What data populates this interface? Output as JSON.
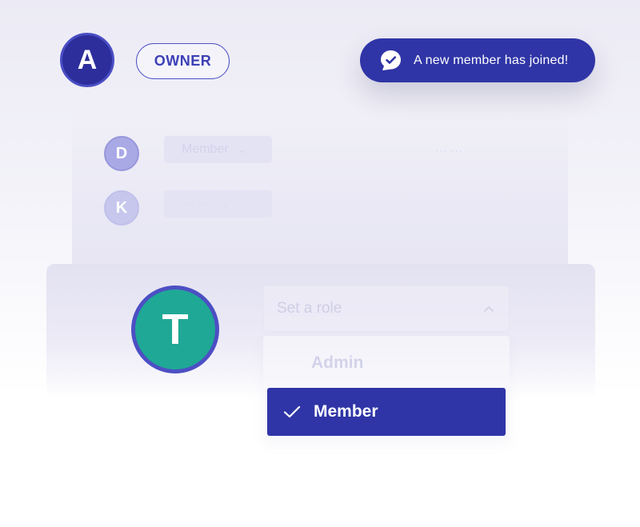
{
  "owner": {
    "avatar_initial": "A",
    "badge_label": "OWNER"
  },
  "toast": {
    "icon": "chat-check-icon",
    "message": "A new member has joined!"
  },
  "members": [
    {
      "initial": "D",
      "role": "Member",
      "extra": "··· ···"
    },
    {
      "initial": "K",
      "role": "··· ···"
    }
  ],
  "new_member": {
    "initial": "T",
    "select_placeholder": "Set a role",
    "options": [
      {
        "label": "Admin",
        "selected": false
      },
      {
        "label": "Member",
        "selected": true
      }
    ]
  },
  "colors": {
    "primary": "#2f35a6",
    "owner_avatar": "#2d2e9c",
    "new_member_avatar": "#1fa896"
  }
}
